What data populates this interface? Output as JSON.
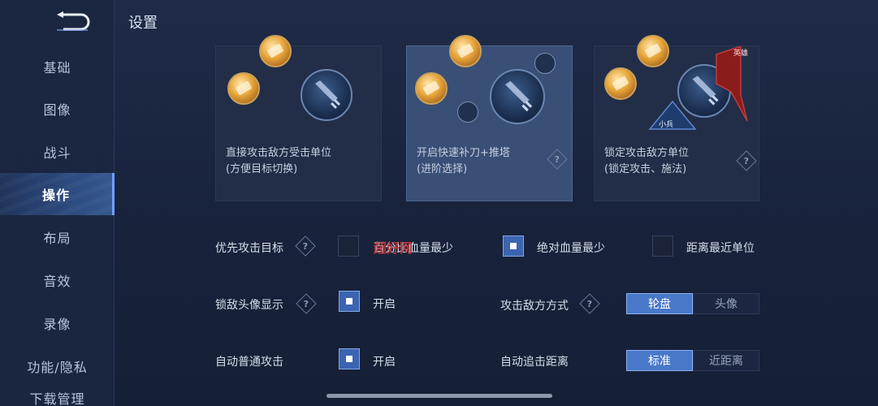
{
  "page_title": "设置",
  "sidebar": {
    "items": [
      {
        "label": "基础",
        "active": false
      },
      {
        "label": "图像",
        "active": false
      },
      {
        "label": "战斗",
        "active": false
      },
      {
        "label": "操作",
        "active": true
      },
      {
        "label": "布局",
        "active": false
      },
      {
        "label": "音效",
        "active": false
      },
      {
        "label": "录像",
        "active": false
      },
      {
        "label": "功能/隐私",
        "active": false
      },
      {
        "label": "下载管理",
        "active": false
      }
    ]
  },
  "attack_modes": [
    {
      "line1": "直接攻击敌方受击单位",
      "line2": "(方便目标切换)",
      "selected": false
    },
    {
      "line1": "开启快速补刀+推塔",
      "line2": "(进阶选择)",
      "selected": true
    },
    {
      "line1": "锁定攻击敌方单位",
      "line2": "(锁定攻击、施法)",
      "selected": false,
      "badge_hero": "英雄",
      "badge_minion": "小兵"
    }
  ],
  "priority": {
    "label": "优先攻击目标",
    "options": [
      {
        "label": "百分比血量最少",
        "checked": false
      },
      {
        "label": "绝对血量最少",
        "checked": true
      },
      {
        "label": "距离最近单位",
        "checked": false
      }
    ]
  },
  "lock_avatar": {
    "label": "锁敌头像显示",
    "option": "开启",
    "checked": true
  },
  "attack_method": {
    "label": "攻击敌方方式",
    "options": [
      "轮盘",
      "头像"
    ],
    "selected": 0
  },
  "auto_attack": {
    "label": "自动普通攻击",
    "option": "开启",
    "checked": true
  },
  "auto_chase": {
    "label": "自动追击距离",
    "options": [
      "标准",
      "近距离"
    ],
    "selected": 0
  },
  "watermark": "超好网",
  "help_glyph": "?",
  "colors": {
    "accent": "#4a78c9",
    "checked": "#3b64b1",
    "background": "#1f2b47"
  }
}
